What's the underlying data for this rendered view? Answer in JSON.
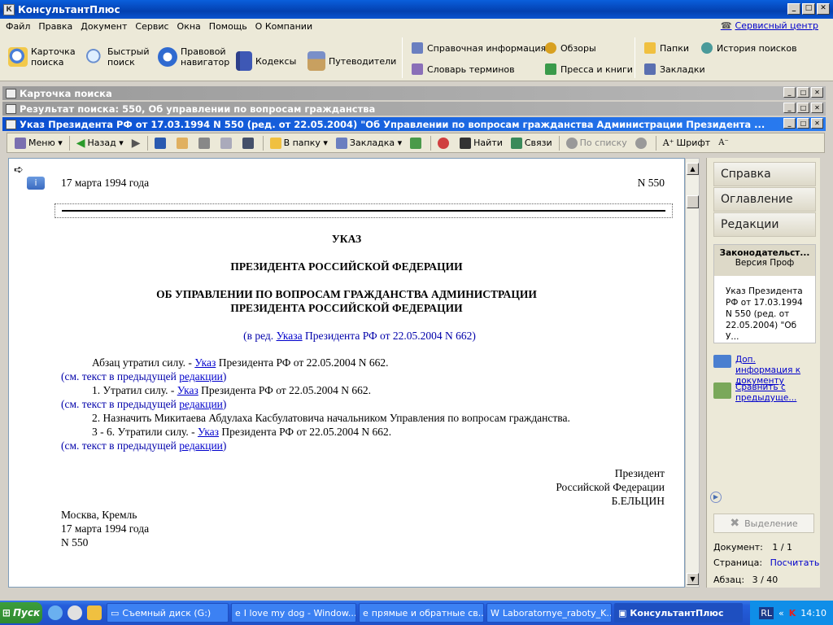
{
  "app": {
    "title": "КонсультантПлюс"
  },
  "menu": {
    "items": [
      "Файл",
      "Правка",
      "Документ",
      "Сервис",
      "Окна",
      "Помощь",
      "О Компании"
    ],
    "service_center": "Сервисный центр"
  },
  "toolbar": {
    "search_card": [
      "Карточка",
      "поиска"
    ],
    "quick_search": [
      "Быстрый",
      "поиск"
    ],
    "legal_nav": [
      "Правовой",
      "навигатор"
    ],
    "codes": "Кодексы",
    "guides": "Путеводители",
    "reference": "Справочная информация",
    "reviews": "Обзоры",
    "dictionary": "Словарь терминов",
    "press": "Пресса и книги",
    "folders": "Папки",
    "history": "История поисков",
    "bookmarks": "Закладки"
  },
  "windows": {
    "search_card": "Карточка поиска",
    "search_result": "Результат поиска: 550, Об управлении по вопросам гражданства",
    "document": "Указ Президента РФ от 17.03.1994 N 550 (ред. от 22.05.2004) \"Об Управлении по вопросам гражданства Администрации Президента ..."
  },
  "doc_toolbar": {
    "menu": "Меню",
    "back": "Назад",
    "to_folder": "В папку",
    "bookmark": "Закладка",
    "find": "Найти",
    "links": "Связи",
    "by_list": "По списку",
    "font": "Шрифт"
  },
  "document": {
    "date": "17 марта 1994 года",
    "number": "N 550",
    "heading1": "УКАЗ",
    "heading2": "ПРЕЗИДЕНТА РОССИЙСКОЙ ФЕДЕРАЦИИ",
    "heading3a": "ОБ УПРАВЛЕНИИ ПО ВОПРОСАМ ГРАЖДАНСТВА АДМИНИСТРАЦИИ",
    "heading3b": "ПРЕЗИДЕНТА РОССИЙСКОЙ ФЕДЕРАЦИИ",
    "edition_pre": "(в ред. ",
    "edition_link": "Указа",
    "edition_post": " Президента РФ от 22.05.2004 N 662)",
    "p1_pre": "Абзац утратил силу. - ",
    "p1_link": "Указ",
    "p1_post": " Президента РФ от 22.05.2004 N 662.",
    "see_pre": "(см. текст в предыдущей ",
    "see_link": "редакции",
    "see_post": ")",
    "p2_pre": "1. Утратил силу. - ",
    "p2_link": "Указ",
    "p2_post": " Президента РФ от 22.05.2004 N 662.",
    "p3": "2. Назначить Микитаева Абдулаха Касбулатовича начальником Управления по вопросам гражданства.",
    "p4_pre": "3 - 6.  Утратили силу. - ",
    "p4_link": "Указ",
    "p4_post": " Президента РФ от 22.05.2004 N 662.",
    "sign1": "Президент",
    "sign2": "Российской Федерации",
    "sign3": "Б.ЕЛЬЦИН",
    "place": "Москва, Кремль",
    "date2": "17 марта 1994 года",
    "number2": "N 550"
  },
  "right_panel": {
    "tabs": [
      "Справка",
      "Оглавление",
      "Редакции"
    ],
    "card_title": "Законодательст...",
    "card_sub": "Версия Проф",
    "card_body": "Указ Президента РФ от 17.03.1994 N 550 (ред. от 22.05.2004) \"Об У...",
    "extra_info": "Доп. информация к документу",
    "compare": "Сравнить с предыдуще...",
    "highlight": "Выделение",
    "doc_label": "Документ:",
    "doc_value": "1 / 1",
    "page_label": "Страница:",
    "page_value": "Посчитать",
    "para_label": "Абзац:",
    "para_value": "3 / 40"
  },
  "taskbar": {
    "start": "Пуск",
    "items": [
      "Съемный диск (G:)",
      "I love my dog - Window...",
      "прямые и обратные св...",
      "Laboratornye_raboty_K...",
      "КонсультантПлюс"
    ],
    "lang": "RL",
    "time": "14:10"
  }
}
